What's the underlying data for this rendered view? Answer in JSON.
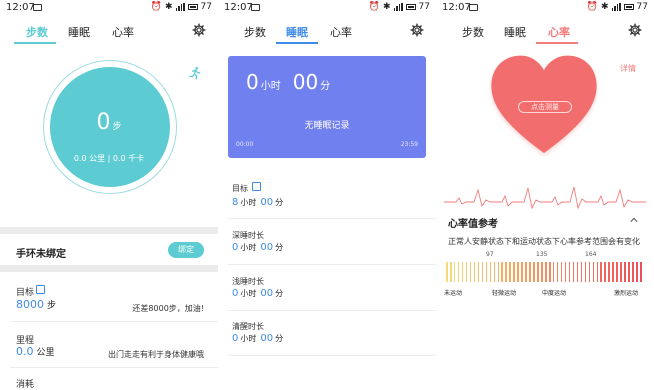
{
  "status": {
    "time": "12:07",
    "battery": "77"
  },
  "tabs": {
    "steps": "步数",
    "sleep": "睡眠",
    "heart": "心率"
  },
  "colors": {
    "steps_accent": "#5ccbd2",
    "sleep_accent": "#3f8ce8",
    "heart_accent": "#f27d7d",
    "sleep_card": "#7080ee"
  },
  "steps": {
    "count": "0",
    "unit": "步",
    "sub": "0.0 公里 | 0.0 千卡",
    "band_status": "手环未绑定",
    "bind_button": "绑定",
    "goal_label": "目标",
    "goal_value": "8000",
    "goal_unit": "步",
    "goal_note": "还差8000步，加油!",
    "distance_label": "里程",
    "distance_value": "0.0",
    "distance_unit": "公里",
    "distance_note": "出门走走有利于身体健康哦",
    "calories_label": "消耗"
  },
  "sleep": {
    "hours": "0",
    "hours_unit": "小时",
    "minutes": "00",
    "minutes_unit": "分",
    "no_record": "无睡眠记录",
    "start_time": "00:00",
    "end_time": "23:59",
    "goal_label": "目标",
    "goal_h": "8",
    "goal_m": "00",
    "deep_label": "深睡时长",
    "light_label": "浅睡时长",
    "awake_label": "清醒时长",
    "zero_h": "0",
    "zero_m": "00",
    "h_unit": "小时",
    "m_unit": "分"
  },
  "heart": {
    "measure_button": "点击测量",
    "detail_link": "详情",
    "ref_title": "心率值参考",
    "ref_desc": "正常人安静状态下和运动状态下心率参考范围会有变化",
    "ticks": [
      "97",
      "135",
      "164"
    ],
    "zones": [
      "未运动",
      "轻微运动",
      "中度运动",
      "激烈运动"
    ]
  }
}
